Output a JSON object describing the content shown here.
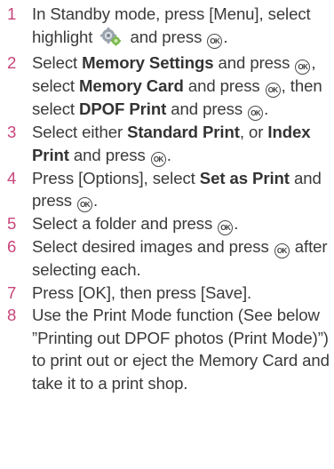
{
  "steps": [
    {
      "num": "1",
      "parts": [
        "In Standby mode, press [Menu], select highlight ",
        " and press ",
        "."
      ]
    },
    {
      "num": "2",
      "parts": [
        "Select ",
        "Memory Settings",
        " and press ",
        ", select ",
        "Memory Card",
        " and press ",
        ", then select ",
        "DPOF Print",
        " and press ",
        "."
      ]
    },
    {
      "num": "3",
      "parts": [
        "Select either ",
        "Standard Print",
        ", or ",
        "Index Print",
        " and press ",
        "."
      ]
    },
    {
      "num": "4",
      "parts": [
        "Press [Options], select ",
        "Set as Print",
        " and press ",
        "."
      ]
    },
    {
      "num": "5",
      "parts": [
        "Select a folder and press ",
        "."
      ]
    },
    {
      "num": "6",
      "parts": [
        "Select desired images and press ",
        " after selecting each."
      ]
    },
    {
      "num": "7",
      "text": "Press [OK], then press [Save]."
    },
    {
      "num": "8",
      "text": "Use the Print Mode function (See below ”Printing out DPOF photos (Print Mode)”) to print out or eject the Memory Card and take it to a print shop."
    }
  ],
  "icons": {
    "ok_label": "OK",
    "settings_icon": "settings-gear-icon"
  },
  "colors": {
    "step_number": "#c8457a",
    "text": "#3a3a3a"
  }
}
